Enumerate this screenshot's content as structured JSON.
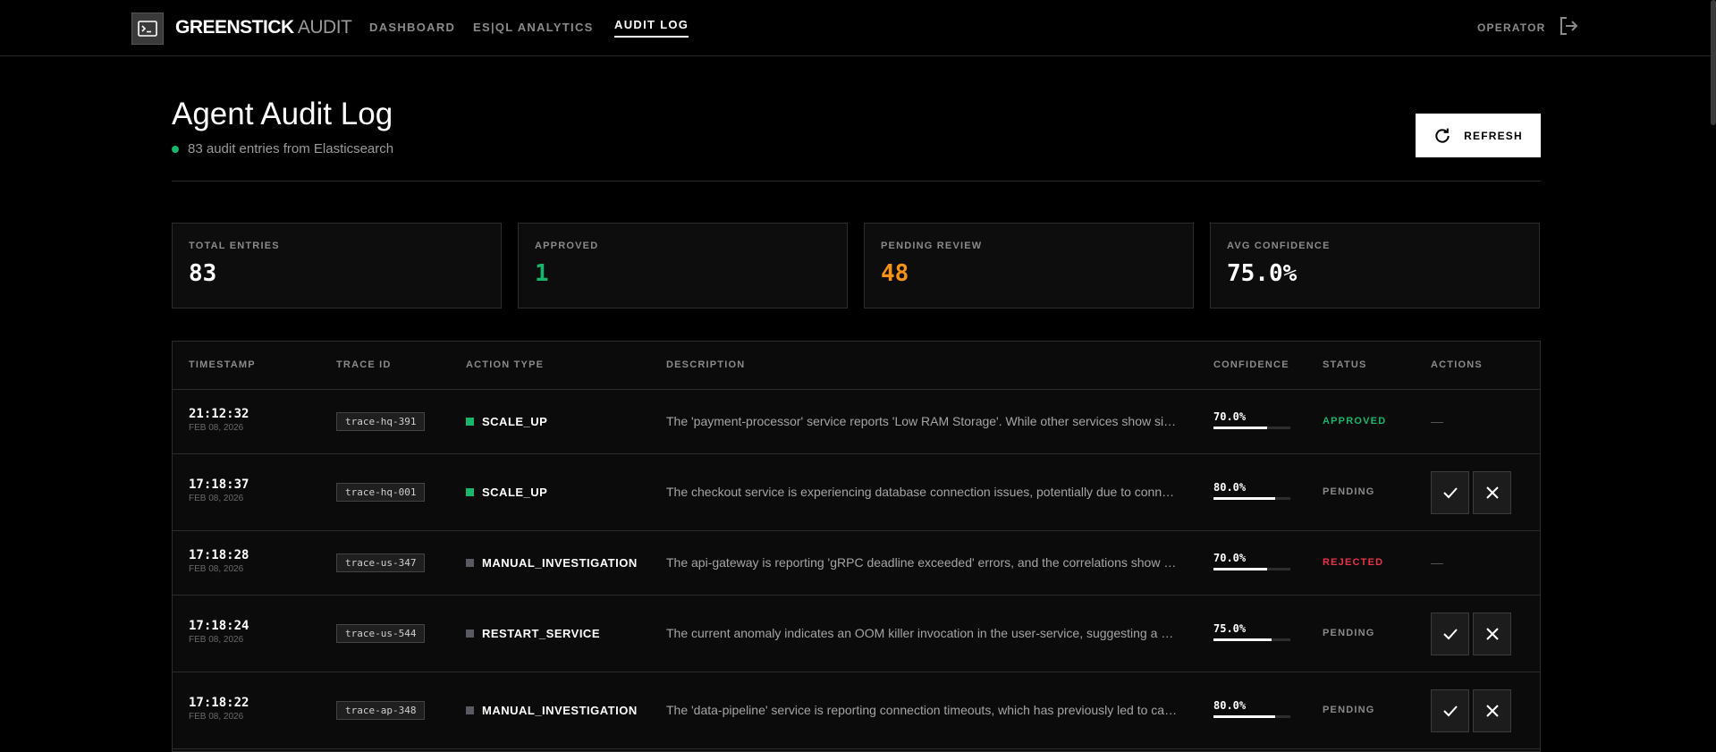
{
  "brand": {
    "bold": "GREENSTICK",
    "light": "AUDIT"
  },
  "nav": {
    "dashboard": "DASHBOARD",
    "analytics": "ES|QL ANALYTICS",
    "audit": "AUDIT LOG"
  },
  "user": {
    "role": "OPERATOR"
  },
  "header": {
    "title": "Agent Audit Log",
    "subtitle": "83 audit entries from Elasticsearch",
    "refresh_label": "REFRESH"
  },
  "stats": [
    {
      "label": "TOTAL ENTRIES",
      "value": "83",
      "color": "#ffffff"
    },
    {
      "label": "APPROVED",
      "value": "1",
      "color": "#18b56b"
    },
    {
      "label": "PENDING REVIEW",
      "value": "48",
      "color": "#f59313"
    },
    {
      "label": "AVG CONFIDENCE",
      "value": "75.0%",
      "color": "#ffffff"
    }
  ],
  "table": {
    "headers": [
      "TIMESTAMP",
      "TRACE ID",
      "ACTION TYPE",
      "DESCRIPTION",
      "CONFIDENCE",
      "STATUS",
      "ACTIONS"
    ],
    "rows": [
      {
        "time": "21:12:32",
        "date": "FEB 08, 2026",
        "trace": "trace-hq-391",
        "action": "SCALE_UP",
        "action_color": "#18b56b",
        "desc": "The 'payment-processor' service reports 'Low RAM Storage'. While other services show signs of elevated load, scaling up is recommended.",
        "confidence": "70.0%",
        "confidence_value": 0.7,
        "status": "APPROVED",
        "status_color": "#18b56b",
        "actionable": false,
        "no_action": "—"
      },
      {
        "time": "17:18:37",
        "date": "FEB 08, 2026",
        "trace": "trace-hq-001",
        "action": "SCALE_UP",
        "action_color": "#18b56b",
        "desc": "The checkout service is experiencing database connection issues, potentially due to connection pool exhaustion under load.",
        "confidence": "80.0%",
        "confidence_value": 0.8,
        "status": "PENDING",
        "status_color": "#8a8a8a",
        "actionable": true,
        "no_action": ""
      },
      {
        "time": "17:18:28",
        "date": "FEB 08, 2026",
        "trace": "trace-us-347",
        "action": "MANUAL_INVESTIGATION",
        "action_color": "#5a5a62",
        "desc": "The api-gateway is reporting 'gRPC deadline exceeded' errors, and the correlations show upstream latency spikes.",
        "confidence": "70.0%",
        "confidence_value": 0.7,
        "status": "REJECTED",
        "status_color": "#e8334a",
        "actionable": false,
        "no_action": "—"
      },
      {
        "time": "17:18:24",
        "date": "FEB 08, 2026",
        "trace": "trace-us-544",
        "action": "RESTART_SERVICE",
        "action_color": "#5a5a62",
        "desc": "The current anomaly indicates an OOM killer invocation in the user-service, suggesting a memory leak.",
        "confidence": "75.0%",
        "confidence_value": 0.75,
        "status": "PENDING",
        "status_color": "#8a8a8a",
        "actionable": true,
        "no_action": ""
      },
      {
        "time": "17:18:22",
        "date": "FEB 08, 2026",
        "trace": "trace-ap-348",
        "action": "MANUAL_INVESTIGATION",
        "action_color": "#5a5a62",
        "desc": "The 'data-pipeline' service is reporting connection timeouts, which has previously led to cascading failures.",
        "confidence": "80.0%",
        "confidence_value": 0.8,
        "status": "PENDING",
        "status_color": "#8a8a8a",
        "actionable": true,
        "no_action": ""
      }
    ]
  },
  "icons": {
    "logo": "terminal-icon",
    "logout": "logout-icon",
    "refresh": "refresh-icon",
    "approve": "check-icon",
    "reject": "close-icon"
  }
}
